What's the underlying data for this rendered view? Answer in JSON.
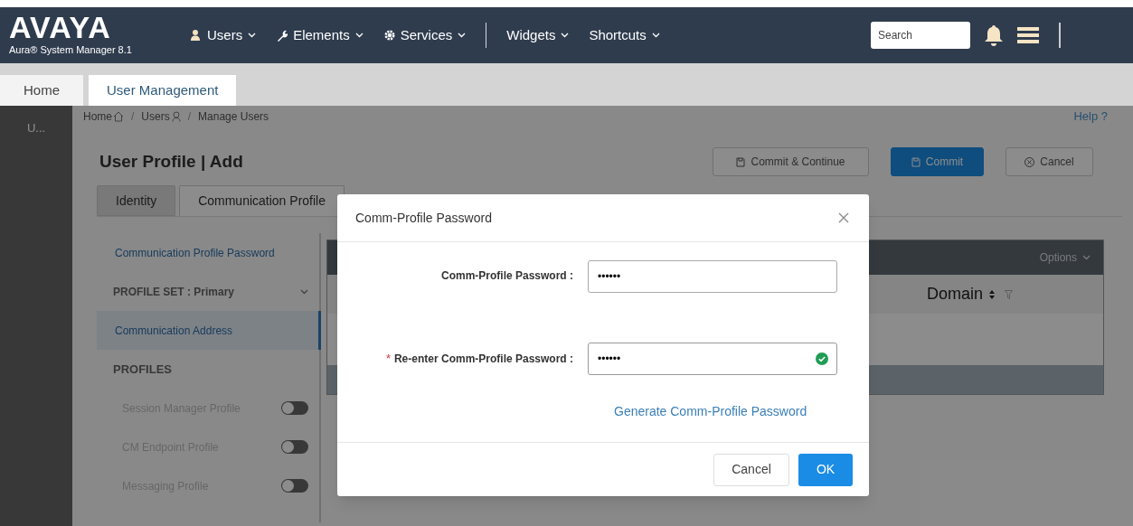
{
  "header": {
    "logo": "AVAYA",
    "subtitle": "Aura® System Manager 8.1",
    "nav": [
      {
        "kind": "users",
        "label": "Users"
      },
      {
        "kind": "elements",
        "label": "Elements"
      },
      {
        "kind": "services",
        "label": "Services"
      },
      {
        "kind": "divider"
      },
      {
        "kind": "plain",
        "label": "Widgets"
      },
      {
        "kind": "plain",
        "label": "Shortcuts"
      }
    ],
    "search": {
      "placeholder": "Search"
    }
  },
  "tabs": [
    {
      "label": "Home",
      "selected": false
    },
    {
      "label": "User Management",
      "selected": true
    }
  ],
  "rail": {
    "label": "U..."
  },
  "breadcrumb": [
    {
      "kind": "home",
      "label": "Home"
    },
    {
      "kind": "separator",
      "label": "/"
    },
    {
      "kind": "users",
      "label": "Users"
    },
    {
      "kind": "separator",
      "label": "/"
    },
    {
      "kind": "plain",
      "label": "Manage Users"
    }
  ],
  "help": "Help ?",
  "page_title": "User Profile | Add",
  "actions": [
    {
      "kind": "secondary",
      "label": "Commit & Continue"
    },
    {
      "kind": "primary",
      "label": "Commit"
    },
    {
      "kind": "cancel",
      "label": "Cancel"
    }
  ],
  "profile_tabs": [
    {
      "label": "Identity",
      "selected": false
    },
    {
      "label": "Communication Profile",
      "selected": true
    }
  ],
  "side_nav": [
    {
      "kind": "link",
      "label": "Communication Profile Password",
      "selected": false
    },
    {
      "kind": "select",
      "label": "PROFILE SET : Primary",
      "selected": false
    },
    {
      "kind": "link",
      "label": "Communication Address",
      "selected": true
    },
    {
      "kind": "heading",
      "label": "PROFILES",
      "selected": false
    },
    {
      "kind": "toggle",
      "label": "Session Manager Profile",
      "on": false,
      "selected": false
    },
    {
      "kind": "toggle",
      "label": "CM Endpoint Profile",
      "on": false,
      "selected": false
    },
    {
      "kind": "toggle",
      "label": "Messaging Profile",
      "on": false,
      "selected": false
    }
  ],
  "table": {
    "options": "Options",
    "columns": [
      "Domain"
    ]
  },
  "dialog": {
    "title": "Comm-Profile Password",
    "fields": [
      {
        "label": "Comm-Profile Password :",
        "value": "••••••",
        "valid": false
      },
      {
        "required_mark": "*",
        "label": "Re-enter Comm-Profile Password :",
        "value": "••••••",
        "valid": true
      }
    ],
    "generate_link": "Generate Comm-Profile Password",
    "buttons": [
      {
        "kind": "cancel",
        "label": "Cancel"
      },
      {
        "kind": "ok",
        "label": "OK"
      }
    ]
  }
}
